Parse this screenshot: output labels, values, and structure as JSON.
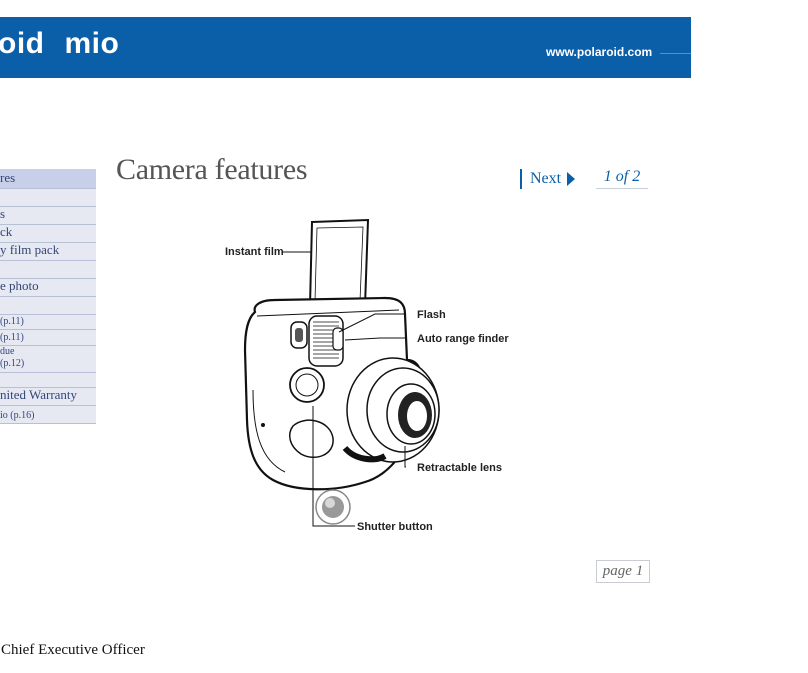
{
  "header": {
    "brand_partial": "oid",
    "brand_product": "mio",
    "website": "www.polaroid.com"
  },
  "sidebar": {
    "items": [
      {
        "label": "res",
        "style": "active"
      },
      {
        "label": "",
        "style": "big"
      },
      {
        "label": "s",
        "style": "big"
      },
      {
        "label": "ck",
        "style": "big"
      },
      {
        "label": "y film pack",
        "style": "big"
      },
      {
        "label": "",
        "style": "big"
      },
      {
        "label": "e photo",
        "style": "big"
      },
      {
        "label": "",
        "style": "big"
      },
      {
        "label": "(p.11)",
        "style": "small"
      },
      {
        "label": "(p.11)",
        "style": "small"
      },
      {
        "label": "due\n(p.12)",
        "style": "small"
      },
      {
        "label": "",
        "style": "small"
      },
      {
        "label": "nited Warranty",
        "style": "big"
      },
      {
        "label": "io (p.16)",
        "style": "small"
      }
    ]
  },
  "main": {
    "title": "Camera features",
    "next_label": "Next",
    "pager": "1 of 2",
    "page_label": "page 1"
  },
  "diagram": {
    "callouts": {
      "instant_film": "Instant film",
      "flash": "Flash",
      "auto_range_finder": "Auto range finder",
      "retractable_lens": "Retractable lens",
      "shutter_button": "Shutter button"
    }
  },
  "footer": {
    "text": "Chief Executive Officer"
  },
  "colors": {
    "brand_blue": "#0b5fa8",
    "sidebar_bg": "#e6e9f1",
    "sidebar_active": "#c7cfe9"
  }
}
